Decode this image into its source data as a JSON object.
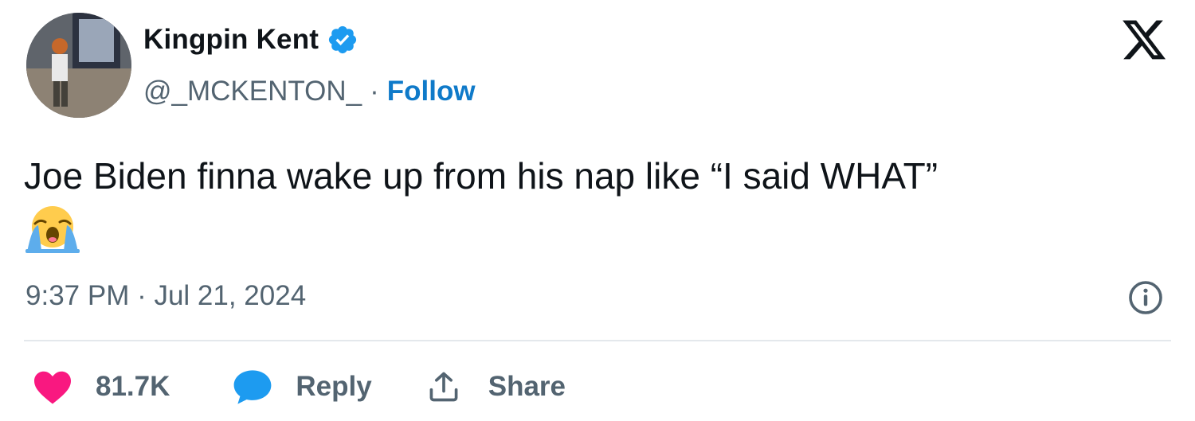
{
  "author": {
    "name": "Kingpin Kent",
    "handle": "@_MCKENTON_",
    "separator": "·",
    "follow_label": "Follow",
    "verified": true
  },
  "tweet": {
    "text": "Joe Biden finna wake up from his nap like “I said WHAT”",
    "emoji": "loudly-crying-face",
    "timestamp": "9:37 PM · Jul 21, 2024"
  },
  "actions": {
    "like_count": "81.7K",
    "reply_label": "Reply",
    "share_label": "Share"
  },
  "icons": {
    "platform_logo": "x-logo-icon",
    "info": "info-icon",
    "like": "heart-icon",
    "reply": "speech-bubble-icon",
    "share": "share-icon"
  },
  "colors": {
    "text": "#0f1419",
    "secondary": "#536471",
    "follow": "#0f7ac9",
    "verified": "#1d9bf0",
    "like": "#f91880",
    "reply": "#1d9bf0",
    "divider": "#e4e8ec"
  }
}
